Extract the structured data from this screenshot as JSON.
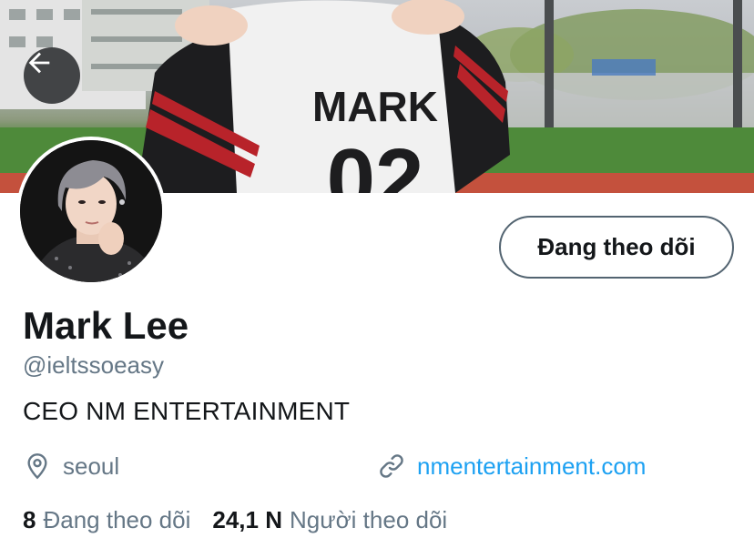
{
  "header": {
    "back_icon": "arrow-left-icon",
    "banner_jersey_name": "MARK",
    "banner_jersey_number": "02"
  },
  "profile": {
    "follow_button_label": "Đang theo dõi",
    "display_name": "Mark Lee",
    "handle": "@ieltssoeasy",
    "bio": "CEO NM ENTERTAINMENT",
    "location": "seoul",
    "location_icon": "location-pin-icon",
    "website": "nmentertainment.com",
    "website_icon": "link-icon"
  },
  "stats": {
    "following_count": "8",
    "following_label": "Đang theo dõi",
    "followers_count": "24,1 N",
    "followers_label": "Người theo dõi"
  },
  "colors": {
    "accent": "#1da1f2",
    "secondary_text": "#657786",
    "primary_text": "#14171a"
  }
}
